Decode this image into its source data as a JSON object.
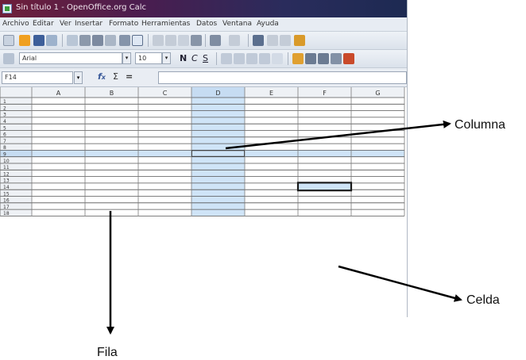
{
  "window": {
    "title": "Sin título 1 - OpenOffice.org Calc"
  },
  "menu": [
    "Archivo",
    "Editar",
    "Ver",
    "Insertar",
    "Formato",
    "Herramientas",
    "Datos",
    "Ventana",
    "Ayuda"
  ],
  "toolbar_format": {
    "font_name": "Arial",
    "font_size": "10",
    "bold": "N",
    "italic": "C",
    "underline": "S"
  },
  "formula_bar": {
    "name_box": "F14",
    "value": ""
  },
  "sheet": {
    "columns": [
      "A",
      "B",
      "C",
      "D",
      "E",
      "F",
      "G"
    ],
    "rows": [
      "1",
      "2",
      "3",
      "4",
      "5",
      "6",
      "7",
      "8",
      "9",
      "10",
      "11",
      "12",
      "13",
      "14",
      "15",
      "16",
      "17",
      "18"
    ],
    "highlight_column": "D",
    "highlight_row": "9",
    "selected_cell": "F14"
  },
  "annotations": {
    "column_label": "Columna",
    "row_label": "Fila",
    "cell_label": "Celda"
  },
  "colors": {
    "highlight": "#cfe4f7",
    "selection_border": "#1a1a1a",
    "titlebar": "#4a1d4f"
  }
}
